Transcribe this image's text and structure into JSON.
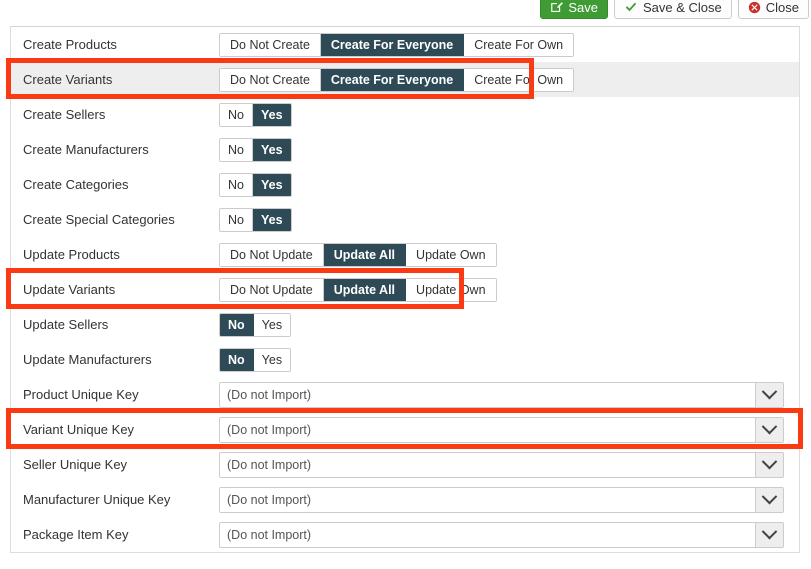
{
  "toolbar": {
    "buttons": [
      {
        "label": "Save",
        "icon": "edit-pencil-icon",
        "style": "primary"
      },
      {
        "label": "Save & Close",
        "icon": "check-icon",
        "style": "plain"
      },
      {
        "label": "Close",
        "icon": "close-circle-icon",
        "style": "plain"
      }
    ]
  },
  "colors": {
    "accent_green": "#3f9c35",
    "selected_dark": "#2e4a57",
    "annotation_red": "#f93a13",
    "row_hover": "#eeeeee",
    "close_red": "#c9302c"
  },
  "form": {
    "rows": [
      {
        "label": "Create Products",
        "type": "segmented",
        "options": [
          "Do Not Create",
          "Create For Everyone",
          "Create For Own"
        ],
        "selected": "Create For Everyone",
        "highlighted": false,
        "hover": false
      },
      {
        "label": "Create Variants",
        "type": "segmented",
        "options": [
          "Do Not Create",
          "Create For Everyone",
          "Create For Own"
        ],
        "selected": "Create For Everyone",
        "highlighted": true,
        "hover": true
      },
      {
        "label": "Create Sellers",
        "type": "segmented",
        "options": [
          "No",
          "Yes"
        ],
        "selected": "Yes",
        "highlighted": false,
        "hover": false
      },
      {
        "label": "Create Manufacturers",
        "type": "segmented",
        "options": [
          "No",
          "Yes"
        ],
        "selected": "Yes",
        "highlighted": false,
        "hover": false
      },
      {
        "label": "Create Categories",
        "type": "segmented",
        "options": [
          "No",
          "Yes"
        ],
        "selected": "Yes",
        "highlighted": false,
        "hover": false
      },
      {
        "label": "Create Special Categories",
        "type": "segmented",
        "options": [
          "No",
          "Yes"
        ],
        "selected": "Yes",
        "highlighted": false,
        "hover": false
      },
      {
        "label": "Update Products",
        "type": "segmented",
        "options": [
          "Do Not Update",
          "Update All",
          "Update Own"
        ],
        "selected": "Update All",
        "highlighted": false,
        "hover": false
      },
      {
        "label": "Update Variants",
        "type": "segmented",
        "options": [
          "Do Not Update",
          "Update All",
          "Update Own"
        ],
        "selected": "Update All",
        "highlighted": true,
        "hover": false
      },
      {
        "label": "Update Sellers",
        "type": "segmented",
        "options": [
          "No",
          "Yes"
        ],
        "selected": "No",
        "highlighted": false,
        "hover": false
      },
      {
        "label": "Update Manufacturers",
        "type": "segmented",
        "options": [
          "No",
          "Yes"
        ],
        "selected": "No",
        "highlighted": false,
        "hover": false
      },
      {
        "label": "Product Unique Key",
        "type": "select",
        "value": "(Do not Import)",
        "highlighted": false,
        "hover": false
      },
      {
        "label": "Variant Unique Key",
        "type": "select",
        "value": "(Do not Import)",
        "highlighted": true,
        "hover": false
      },
      {
        "label": "Seller Unique Key",
        "type": "select",
        "value": "(Do not Import)",
        "highlighted": false,
        "hover": false
      },
      {
        "label": "Manufacturer Unique Key",
        "type": "select",
        "value": "(Do not Import)",
        "highlighted": false,
        "hover": false
      },
      {
        "label": "Package Item Key",
        "type": "select",
        "value": "(Do not Import)",
        "highlighted": false,
        "hover": false
      }
    ]
  }
}
